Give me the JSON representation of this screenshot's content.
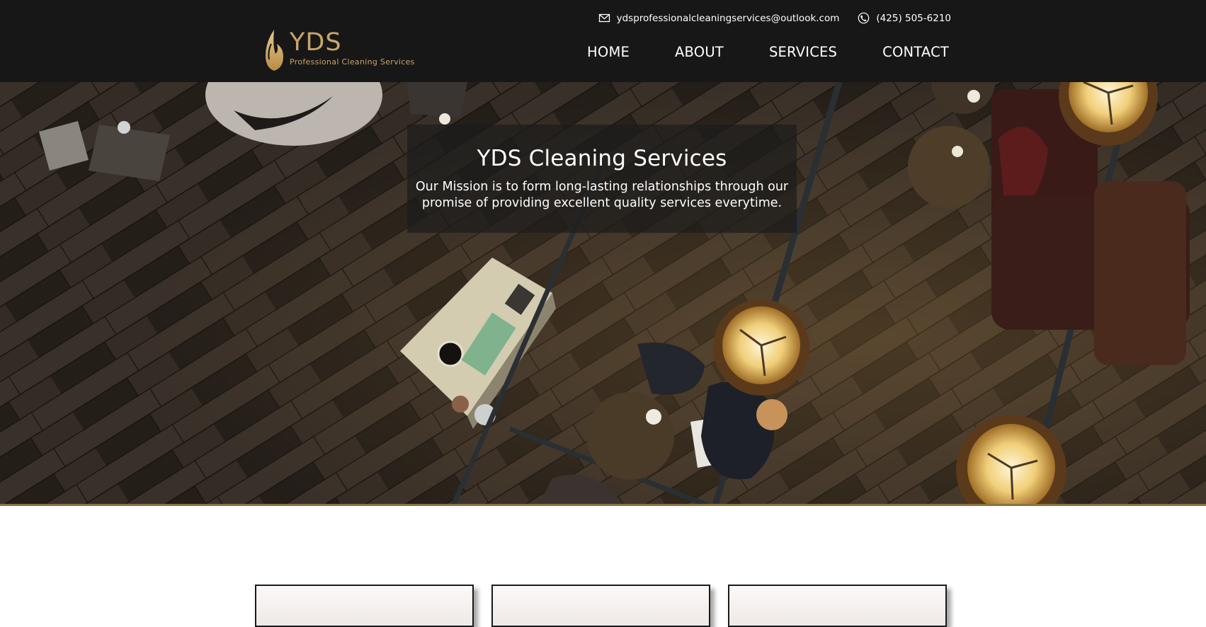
{
  "header": {
    "email": "ydsprofessionalcleaningservices@outlook.com",
    "phone": "(425) 505-6210",
    "logo": {
      "brand": "YDS",
      "tagline": "Professional Cleaning Services"
    },
    "nav": [
      "HOME",
      "ABOUT",
      "SERVICES",
      "CONTACT"
    ]
  },
  "hero": {
    "title": "YDS Cleaning Services",
    "mission": "Our Mission is to form long-lasting relationships through our promise of providing excellent quality services everytime."
  },
  "icons": {
    "email": "envelope-icon",
    "phone": "phone-icon",
    "logo": "flame-drop-icon"
  },
  "colors": {
    "header_bg": "#171717",
    "gold": "#c9a469",
    "hero_accent_line": "#8c7142"
  }
}
